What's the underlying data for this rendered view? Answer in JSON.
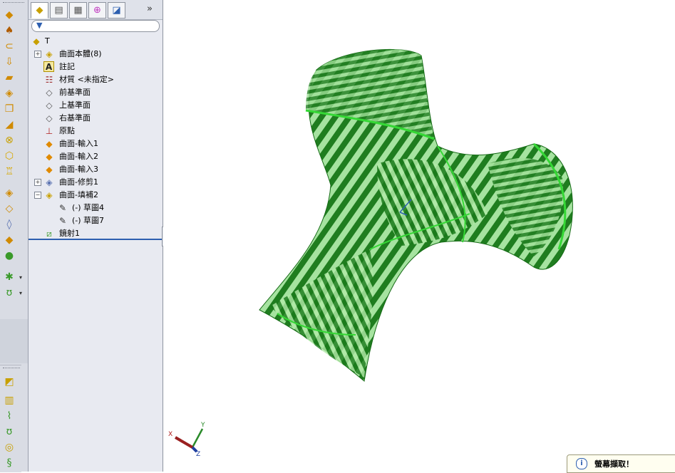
{
  "feature_tree": {
    "root": "T",
    "items": [
      {
        "label": "曲面本體(8)",
        "icon": "surface-bodies-folder-icon",
        "expander": "+"
      },
      {
        "label": "註記",
        "icon": "annotations-icon",
        "expander": ""
      },
      {
        "label": "材質 <未指定>",
        "icon": "material-icon",
        "expander": ""
      },
      {
        "label": "前基準面",
        "icon": "plane-icon",
        "expander": ""
      },
      {
        "label": "上基準面",
        "icon": "plane-icon",
        "expander": ""
      },
      {
        "label": "右基準面",
        "icon": "plane-icon",
        "expander": ""
      },
      {
        "label": "原點",
        "icon": "origin-icon",
        "expander": ""
      },
      {
        "label": "曲面-輸入1",
        "icon": "imported-surface-icon",
        "expander": ""
      },
      {
        "label": "曲面-輸入2",
        "icon": "imported-surface-icon",
        "expander": ""
      },
      {
        "label": "曲面-輸入3",
        "icon": "imported-surface-icon",
        "expander": ""
      },
      {
        "label": "曲面-修剪1",
        "icon": "trim-surface-icon",
        "expander": "+"
      },
      {
        "label": "曲面-填補2",
        "icon": "filled-surface-icon",
        "expander": "−"
      },
      {
        "label": "(-) 草圖4",
        "icon": "sketch-icon",
        "expander": ""
      },
      {
        "label": "(-) 草圖7",
        "icon": "sketch-icon",
        "expander": ""
      },
      {
        "label": "鏡射1",
        "icon": "mirror-icon",
        "expander": ""
      }
    ]
  },
  "triad": {
    "x": "X",
    "y": "Y",
    "z": "Z"
  },
  "status_tip": {
    "text": "螢幕擷取！",
    "icon": "i"
  },
  "colors": {
    "accent": "#2d5fb0",
    "model_dark": "#1e7a1e",
    "model_light": "#9fe09a"
  }
}
